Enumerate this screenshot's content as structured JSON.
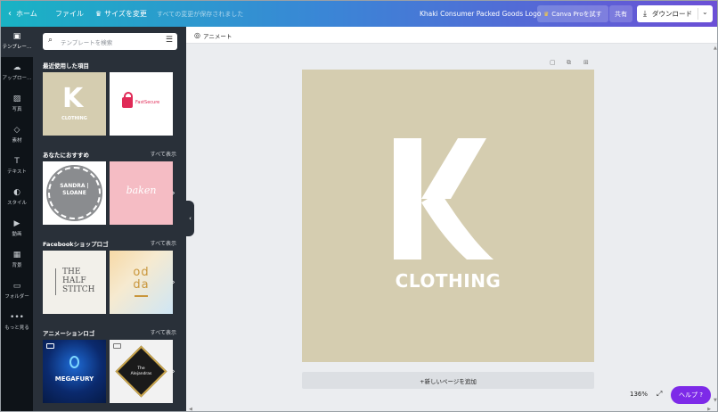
{
  "topbar": {
    "home": "ホーム",
    "file": "ファイル",
    "resize": "サイズを変更",
    "saved": "すべての変更が保存されました",
    "title": "Khaki Consumer Packed Goods Logo",
    "pro": "Canva Proを試す",
    "share": "共有",
    "download": "ダウンロード"
  },
  "rail": {
    "items": [
      {
        "label": "テンプレー…",
        "icon": "template-icon"
      },
      {
        "label": "アップロー…",
        "icon": "upload-icon"
      },
      {
        "label": "写真",
        "icon": "photo-icon"
      },
      {
        "label": "素材",
        "icon": "elements-icon"
      },
      {
        "label": "テキスト",
        "icon": "text-icon"
      },
      {
        "label": "スタイル",
        "icon": "style-icon"
      },
      {
        "label": "動画",
        "icon": "video-icon"
      },
      {
        "label": "背景",
        "icon": "background-icon"
      },
      {
        "label": "フォルダー",
        "icon": "folder-icon"
      },
      {
        "label": "もっと見る",
        "icon": "more-icon"
      }
    ]
  },
  "panel": {
    "search_placeholder": "テンプレートを検索",
    "sections": [
      {
        "title": "最近使用した項目",
        "see_all": ""
      },
      {
        "title": "あなたにおすすめ",
        "see_all": "すべて表示"
      },
      {
        "title": "Facebookショップロゴ",
        "see_all": "すべて表示"
      },
      {
        "title": "アニメーションロゴ",
        "see_all": "すべて表示"
      }
    ],
    "thumbs": {
      "k_letter": "K",
      "k_caption": "CLOTHING",
      "lock_caption": "FastSecure",
      "sandra_line1": "SANDRA |",
      "sandra_line2": "SLOANE",
      "baken": "baken",
      "half_line1": "THE",
      "half_line2": "HALF",
      "half_line3": "STITCH",
      "odda_line1": "od",
      "odda_line2": "da",
      "mega": "MEGAFURY",
      "alex_line1": "The",
      "alex_line2": "Alejandras"
    }
  },
  "editor": {
    "animate": "アニメート",
    "canvas_text": "CLOTHING",
    "add_page": "+新しいページを追加",
    "zoom": "136%",
    "help": "ヘルプ ?"
  },
  "colors": {
    "accent": "#7d2ae8",
    "khaki": "#d5cdb0",
    "panel": "#293039"
  }
}
